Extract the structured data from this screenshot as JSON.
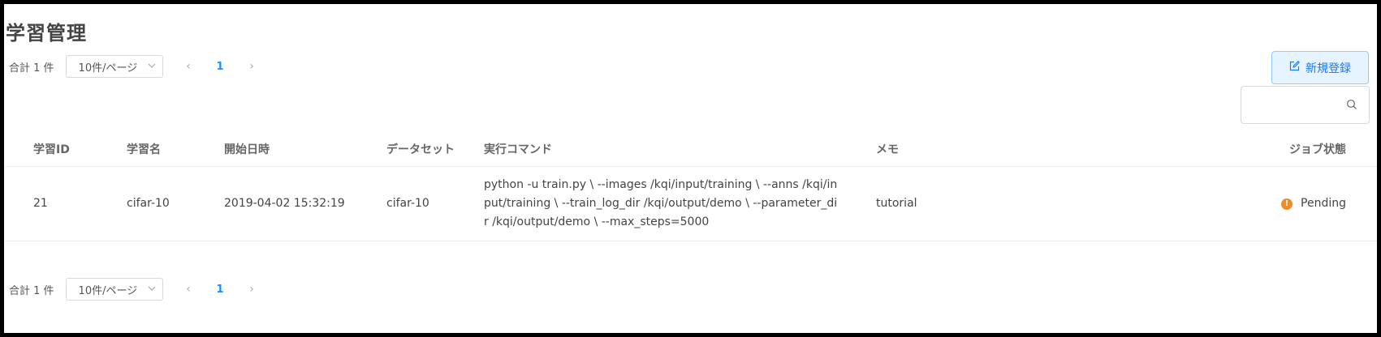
{
  "page": {
    "title": "学習管理"
  },
  "pagination": {
    "total_label": "合計 1 件",
    "per_page": "10件/ページ",
    "prev_icon": "‹",
    "next_icon": "›",
    "current_page": "1"
  },
  "toolbar": {
    "new_button_label": "新規登録",
    "search_placeholder": ""
  },
  "table": {
    "columns": [
      "学習ID",
      "学習名",
      "開始日時",
      "データセット",
      "実行コマンド",
      "メモ",
      "ジョブ状態"
    ],
    "rows": [
      {
        "id": "21",
        "name": "cifar-10",
        "started": "2019-04-02 15:32:19",
        "dataset": "cifar-10",
        "command": "python -u train.py \\ --images /kqi/input/training \\ --anns /kqi/input/training \\ --train_log_dir /kqi/output/demo \\ --parameter_dir /kqi/output/demo \\ --max_steps=5000",
        "memo": "tutorial",
        "status": "Pending",
        "status_icon": "!"
      }
    ]
  },
  "colors": {
    "accent": "#1677ff",
    "pending": "#ee8c2b",
    "button_bg": "#e6f4ff"
  }
}
